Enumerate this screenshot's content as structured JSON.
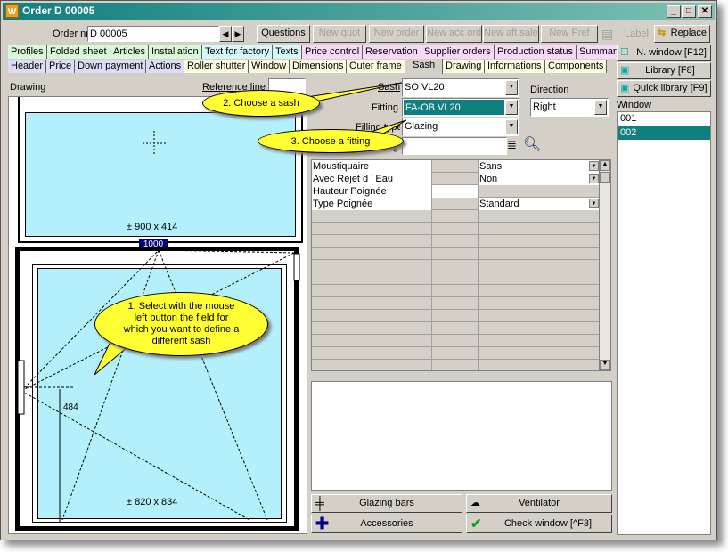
{
  "window": {
    "title": "Order D 00005",
    "app_icon": "W"
  },
  "toolbar": {
    "order_label": "Order nr",
    "order_value": "D 00005",
    "buttons": [
      "Questions",
      "New quot",
      "New order",
      "New acc ord",
      "New aft.sales",
      "New Pref"
    ],
    "label": "Label",
    "replace": "Replace"
  },
  "tabs_row1": [
    "Profiles",
    "Folded sheet",
    "Articles",
    "Installation",
    "Text for factory",
    "Texts",
    "Price control",
    "Reservation",
    "Supplier orders",
    "Production status",
    "Summary"
  ],
  "tabs_row2": [
    "Header",
    "Price",
    "Down payment",
    "Actions",
    "Roller shutter",
    "Window",
    "Dimensions",
    "Outer frame",
    "Sash",
    "Drawing",
    "Informations",
    "Components"
  ],
  "drawing": {
    "label": "Drawing",
    "reference_line_label": "Reference line",
    "top_dim": "± 900 x 414",
    "width_badge": "1000",
    "handle_height": "484",
    "bottom_dim": "± 820 x 834"
  },
  "form": {
    "sash_label": "Sash",
    "sash_value": "SO VL20",
    "fitting_label": "Fitting",
    "fitting_value": "FA-OB VL20",
    "filling_label": "Filling type",
    "filling_value": "Glazing",
    "fourth_label": "...ing",
    "direction_label": "Direction",
    "direction_value": "Right"
  },
  "properties": [
    {
      "name": "Moustiquaire",
      "value": "Sans",
      "dropdown": true
    },
    {
      "name": "Avec Rejet d ' Eau",
      "value": "Non",
      "dropdown": true
    },
    {
      "name": "Hauteur Poignée",
      "value": "",
      "dropdown": false
    },
    {
      "name": "Type Poignée",
      "value": "Standard",
      "dropdown": true
    }
  ],
  "bottom_buttons": {
    "glazing_bars": "Glazing bars",
    "ventilator": "Ventilator",
    "accessories": "Accessories",
    "check_window": "Check window [^F3]"
  },
  "side": {
    "new_window": "N. window [F12]",
    "library": "Library [F8]",
    "quick_library": "Quick library [F9]",
    "window_label": "Window",
    "windows": [
      "001",
      "002"
    ],
    "selected": "002"
  },
  "callouts": {
    "c1": "1. Select with the mouse left button the field for which you want to define a different sash",
    "c2": "2. Choose a sash",
    "c3": "3. Choose a fitting"
  },
  "colors": {
    "title": "#0f7f7f",
    "selection": "#0f7f7f",
    "glass": "#b3f0fb",
    "callout": "#ffff33"
  }
}
